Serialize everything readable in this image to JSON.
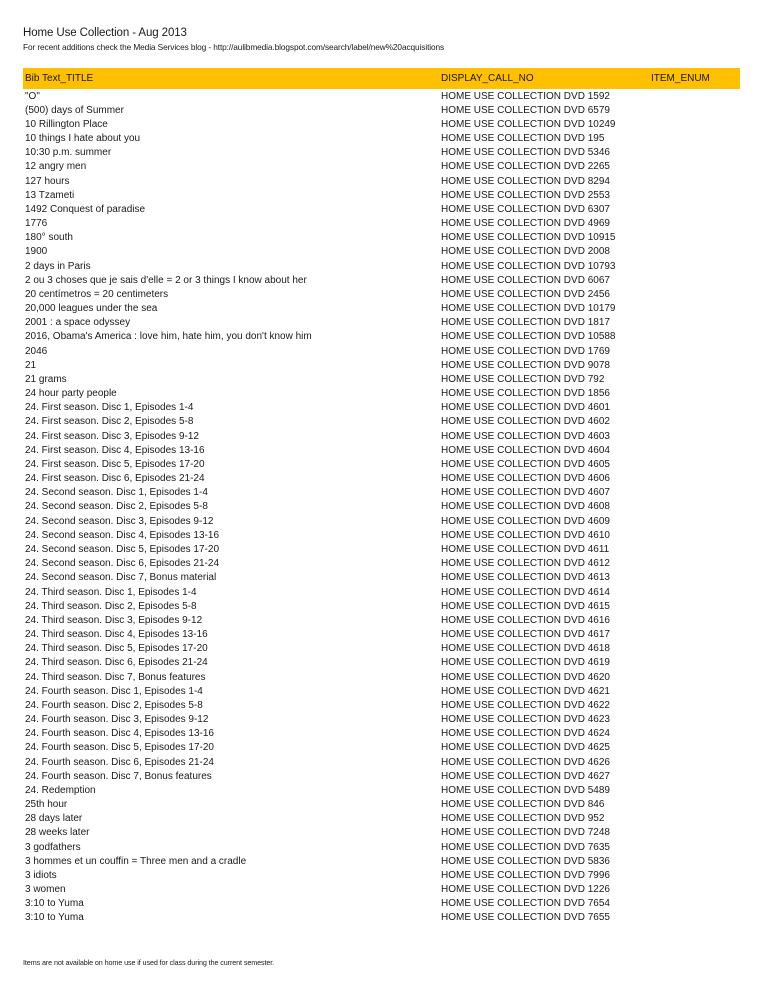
{
  "document": {
    "title": "Home Use Collection - Aug 2013",
    "subtitle": "For recent additions check the Media Services blog - http://aulibmedia.blogspot.com/search/label/new%20acquisitions",
    "header_color": "#ffc000",
    "footer_note": "Items are not available on home use if used for class during the current semester."
  },
  "table": {
    "columns": [
      "Bib Text_TITLE",
      "DISPLAY_CALL_NO",
      "ITEM_ENUM"
    ],
    "rows": [
      {
        "title": "\"O\"",
        "call_no": "HOME USE COLLECTION DVD 1592",
        "item_enum": ""
      },
      {
        "title": "(500) days of Summer",
        "call_no": "HOME USE COLLECTION DVD 6579",
        "item_enum": ""
      },
      {
        "title": "10 Rillington Place",
        "call_no": "HOME USE COLLECTION DVD 10249",
        "item_enum": ""
      },
      {
        "title": "10 things I hate about you",
        "call_no": "HOME USE COLLECTION DVD 195",
        "item_enum": ""
      },
      {
        "title": "10:30 p.m. summer",
        "call_no": "HOME USE COLLECTION DVD 5346",
        "item_enum": ""
      },
      {
        "title": "12 angry men",
        "call_no": "HOME USE COLLECTION DVD 2265",
        "item_enum": ""
      },
      {
        "title": "127 hours",
        "call_no": "HOME USE COLLECTION DVD 8294",
        "item_enum": ""
      },
      {
        "title": "13 Tzameti",
        "call_no": "HOME USE COLLECTION DVD 2553",
        "item_enum": ""
      },
      {
        "title": "1492  Conquest of paradise",
        "call_no": "HOME USE COLLECTION DVD 6307",
        "item_enum": ""
      },
      {
        "title": "1776",
        "call_no": "HOME USE COLLECTION DVD 4969",
        "item_enum": ""
      },
      {
        "title": "180° south",
        "call_no": "HOME USE COLLECTION DVD 10915",
        "item_enum": ""
      },
      {
        "title": "1900",
        "call_no": "HOME USE COLLECTION DVD 2008",
        "item_enum": ""
      },
      {
        "title": "2 days in Paris",
        "call_no": "HOME USE COLLECTION DVD 10793",
        "item_enum": ""
      },
      {
        "title": "2 ou 3 choses que je sais d'elle = 2 or 3 things I know about her",
        "call_no": "HOME USE COLLECTION DVD 6067",
        "item_enum": ""
      },
      {
        "title": "20 centímetros = 20 centimeters",
        "call_no": "HOME USE COLLECTION DVD 2456",
        "item_enum": ""
      },
      {
        "title": "20,000 leagues under the sea",
        "call_no": "HOME USE COLLECTION DVD 10179",
        "item_enum": ""
      },
      {
        "title": "2001  : a space odyssey",
        "call_no": "HOME USE COLLECTION DVD 1817",
        "item_enum": ""
      },
      {
        "title": "2016, Obama's America  : love him, hate him, you don't know him",
        "call_no": "HOME USE COLLECTION DVD 10588",
        "item_enum": ""
      },
      {
        "title": "2046",
        "call_no": "HOME USE COLLECTION DVD 1769",
        "item_enum": ""
      },
      {
        "title": "21",
        "call_no": "HOME USE COLLECTION DVD 9078",
        "item_enum": ""
      },
      {
        "title": "21 grams",
        "call_no": "HOME USE COLLECTION DVD 792",
        "item_enum": ""
      },
      {
        "title": "24 hour party people",
        "call_no": "HOME USE COLLECTION DVD 1856",
        "item_enum": ""
      },
      {
        "title": "24. First season. Disc 1, Episodes 1-4",
        "call_no": "HOME USE COLLECTION DVD 4601",
        "item_enum": ""
      },
      {
        "title": "24. First season. Disc 2, Episodes 5-8",
        "call_no": "HOME USE COLLECTION DVD 4602",
        "item_enum": ""
      },
      {
        "title": "24. First season. Disc 3, Episodes 9-12",
        "call_no": "HOME USE COLLECTION DVD 4603",
        "item_enum": ""
      },
      {
        "title": "24. First season. Disc 4, Episodes 13-16",
        "call_no": "HOME USE COLLECTION DVD 4604",
        "item_enum": ""
      },
      {
        "title": "24. First season. Disc 5, Episodes 17-20",
        "call_no": "HOME USE COLLECTION DVD 4605",
        "item_enum": ""
      },
      {
        "title": "24. First season. Disc 6, Episodes 21-24",
        "call_no": "HOME USE COLLECTION DVD 4606",
        "item_enum": ""
      },
      {
        "title": "24. Second season. Disc 1, Episodes 1-4",
        "call_no": "HOME USE COLLECTION DVD 4607",
        "item_enum": ""
      },
      {
        "title": "24. Second season. Disc 2, Episodes 5-8",
        "call_no": "HOME USE COLLECTION DVD 4608",
        "item_enum": ""
      },
      {
        "title": "24. Second season. Disc 3, Episodes 9-12",
        "call_no": "HOME USE COLLECTION DVD 4609",
        "item_enum": ""
      },
      {
        "title": "24. Second season. Disc 4, Episodes 13-16",
        "call_no": "HOME USE COLLECTION DVD 4610",
        "item_enum": ""
      },
      {
        "title": "24. Second season. Disc 5, Episodes 17-20",
        "call_no": "HOME USE COLLECTION DVD 4611",
        "item_enum": ""
      },
      {
        "title": "24. Second season. Disc 6, Episodes 21-24",
        "call_no": "HOME USE COLLECTION DVD 4612",
        "item_enum": ""
      },
      {
        "title": "24. Second season. Disc 7, Bonus material",
        "call_no": "HOME USE COLLECTION DVD 4613",
        "item_enum": ""
      },
      {
        "title": "24. Third season. Disc 1, Episodes 1-4",
        "call_no": "HOME USE COLLECTION DVD 4614",
        "item_enum": ""
      },
      {
        "title": "24. Third season. Disc 2, Episodes 5-8",
        "call_no": "HOME USE COLLECTION DVD 4615",
        "item_enum": ""
      },
      {
        "title": "24. Third season. Disc 3, Episodes 9-12",
        "call_no": "HOME USE COLLECTION DVD 4616",
        "item_enum": ""
      },
      {
        "title": "24. Third season. Disc 4, Episodes 13-16",
        "call_no": "HOME USE COLLECTION DVD 4617",
        "item_enum": ""
      },
      {
        "title": "24. Third season. Disc 5, Episodes 17-20",
        "call_no": "HOME USE COLLECTION DVD 4618",
        "item_enum": ""
      },
      {
        "title": "24. Third season. Disc 6, Episodes 21-24",
        "call_no": "HOME USE COLLECTION DVD 4619",
        "item_enum": ""
      },
      {
        "title": "24. Third season. Disc 7, Bonus features",
        "call_no": "HOME USE COLLECTION DVD 4620",
        "item_enum": ""
      },
      {
        "title": "24. Fourth season. Disc 1, Episodes 1-4",
        "call_no": "HOME USE COLLECTION DVD 4621",
        "item_enum": ""
      },
      {
        "title": "24. Fourth season. Disc 2, Episodes 5-8",
        "call_no": "HOME USE COLLECTION DVD 4622",
        "item_enum": ""
      },
      {
        "title": "24. Fourth season. Disc 3, Episodes 9-12",
        "call_no": "HOME USE COLLECTION DVD 4623",
        "item_enum": ""
      },
      {
        "title": "24. Fourth season. Disc 4, Episodes 13-16",
        "call_no": "HOME USE COLLECTION DVD 4624",
        "item_enum": ""
      },
      {
        "title": "24. Fourth season. Disc 5, Episodes 17-20",
        "call_no": "HOME USE COLLECTION DVD 4625",
        "item_enum": ""
      },
      {
        "title": "24. Fourth season. Disc 6, Episodes 21-24",
        "call_no": "HOME USE COLLECTION DVD 4626",
        "item_enum": ""
      },
      {
        "title": "24. Fourth season. Disc 7, Bonus features",
        "call_no": "HOME USE COLLECTION DVD 4627",
        "item_enum": ""
      },
      {
        "title": "24. Redemption",
        "call_no": "HOME USE COLLECTION DVD 5489",
        "item_enum": ""
      },
      {
        "title": "25th hour",
        "call_no": "HOME USE COLLECTION DVD 846",
        "item_enum": ""
      },
      {
        "title": "28 days later",
        "call_no": "HOME USE COLLECTION DVD 952",
        "item_enum": ""
      },
      {
        "title": "28 weeks later",
        "call_no": "HOME USE COLLECTION DVD 7248",
        "item_enum": ""
      },
      {
        "title": "3 godfathers",
        "call_no": "HOME USE COLLECTION DVD 7635",
        "item_enum": ""
      },
      {
        "title": "3 hommes et un couffin = Three men and a cradle",
        "call_no": "HOME USE COLLECTION DVD 5836",
        "item_enum": ""
      },
      {
        "title": "3 idiots",
        "call_no": "HOME USE COLLECTION DVD 7996",
        "item_enum": ""
      },
      {
        "title": "3 women",
        "call_no": "HOME USE COLLECTION DVD 1226",
        "item_enum": ""
      },
      {
        "title": "3:10 to Yuma",
        "call_no": "HOME USE COLLECTION DVD 7654",
        "item_enum": ""
      },
      {
        "title": "3:10 to Yuma",
        "call_no": "HOME USE COLLECTION DVD 7655",
        "item_enum": ""
      }
    ]
  }
}
